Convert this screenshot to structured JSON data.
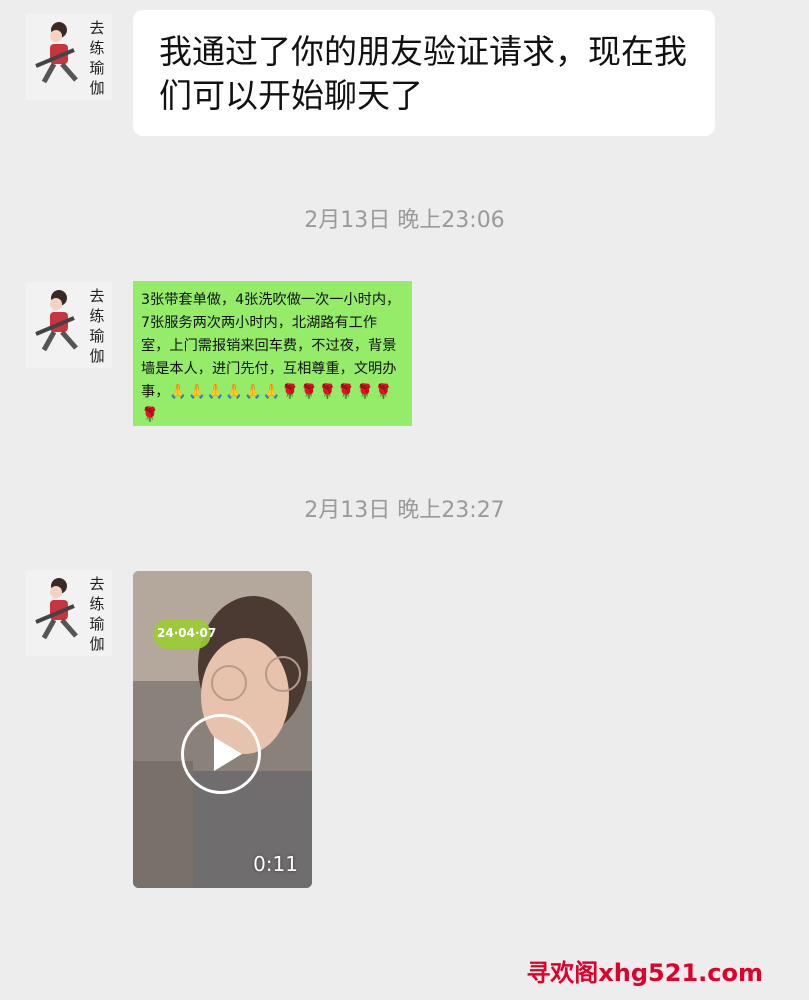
{
  "contact": {
    "name_chars": [
      "去",
      "练",
      "瑜",
      "伽"
    ]
  },
  "messages": {
    "first": "我通过了你的朋友验证请求，现在我们可以开始聊天了",
    "timestamp_1": "2月13日 晚上23:06",
    "second_text": "3张带套单做，4张洗吹做一次一小时内，7张服务两次两小时内，北湖路有工作室，上门需报销来回车费，不过夜，背景墙是本人，进门先付，互相尊重，文明办事，",
    "second_emojis": "🙏🙏🙏🙏🙏🙏🌹🌹🌹🌹🌹🌹🌹",
    "timestamp_2": "2月13日 晚上23:27",
    "video": {
      "duration": "0:11",
      "stamp_text": "24·04·07"
    }
  },
  "watermark": "寻欢阁xhg521.com",
  "colors": {
    "background": "#ededed",
    "incoming_bubble": "#ffffff",
    "green_bubble": "#95ec69",
    "timestamp": "#9a9a9a",
    "watermark": "#e0002b"
  },
  "icons": {
    "video_play": "play-icon"
  }
}
